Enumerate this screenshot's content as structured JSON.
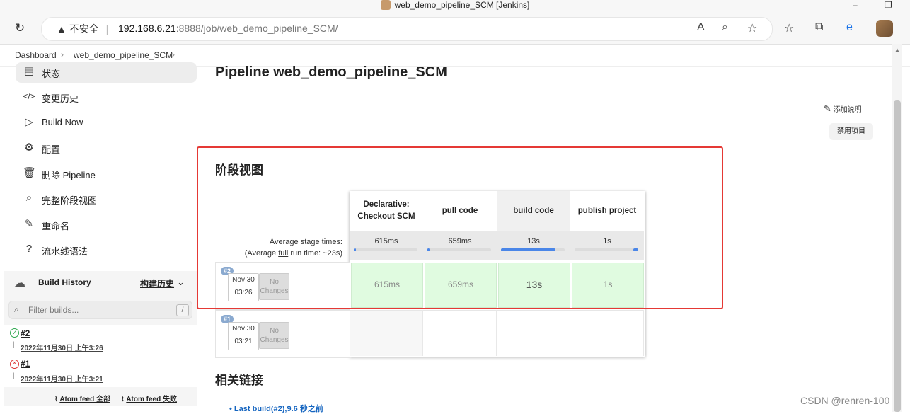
{
  "window": {
    "title": "web_demo_pipeline_SCM [Jenkins]",
    "minimize": "–",
    "restore": "❐"
  },
  "browser": {
    "insecure_label": "不安全",
    "url_host": "192.168.6.21",
    "url_rest": ":8888/job/web_demo_pipeline_SCM/"
  },
  "breadcrumb": [
    "Dashboard",
    "web_demo_pipeline_SCM"
  ],
  "sidebar": {
    "items": [
      {
        "label": "状态",
        "icon": "document-icon"
      },
      {
        "label": "变更历史",
        "icon": "code-icon"
      },
      {
        "label": "Build Now",
        "icon": "play-icon"
      },
      {
        "label": "配置",
        "icon": "gear-icon"
      },
      {
        "label": "删除 Pipeline",
        "icon": "trash-icon"
      },
      {
        "label": "完整阶段视图",
        "icon": "search-icon"
      },
      {
        "label": "重命名",
        "icon": "pencil-icon"
      },
      {
        "label": "流水线语法",
        "icon": "help-icon"
      }
    ]
  },
  "build_history": {
    "title": "Build History",
    "trend": "构建历史",
    "filter_placeholder": "Filter builds...",
    "filter_key": "/",
    "builds": [
      {
        "num": "#2",
        "date": "2022年11月30日 上午3:26",
        "status": "success"
      },
      {
        "num": "#1",
        "date": "2022年11月30日 上午3:21",
        "status": "failed"
      }
    ],
    "feed_all": "Atom feed 全部",
    "feed_fail": "Atom feed 失败"
  },
  "main": {
    "title": "Pipeline web_demo_pipeline_SCM",
    "add_description": "添加说明",
    "disable_project": "禁用项目",
    "stage_view_title": "阶段视图",
    "avg_stage_times": "Average stage times:",
    "avg_run_prefix": "(Average ",
    "avg_run_full": "full",
    "avg_run_suffix": " run time: ~23s)",
    "related_links_title": "相关链接",
    "last_build": "Last build(#2),9.6 秒之前"
  },
  "stages": [
    {
      "name": "Declarative: Checkout SCM",
      "avg": "615ms",
      "avg_fraction": 0.03
    },
    {
      "name": "pull code",
      "avg": "659ms",
      "avg_fraction": 0.03
    },
    {
      "name": "build code",
      "avg": "13s",
      "avg_fraction": 0.85
    },
    {
      "name": "publish project",
      "avg": "1s",
      "avg_fraction": 0.08
    }
  ],
  "runs": [
    {
      "badge": "#2",
      "date": "Nov 30",
      "time": "03:26",
      "changes": "No Changes",
      "cells": [
        "615ms",
        "659ms",
        "13s",
        "1s"
      ]
    },
    {
      "badge": "#1",
      "date": "Nov 30",
      "time": "03:21",
      "changes": "No Changes",
      "cells": []
    }
  ],
  "watermark": "CSDN @renren-100",
  "colors": {
    "success": "#e0fbe0",
    "highlight": "#e53935",
    "bar": "#4a86e8"
  }
}
